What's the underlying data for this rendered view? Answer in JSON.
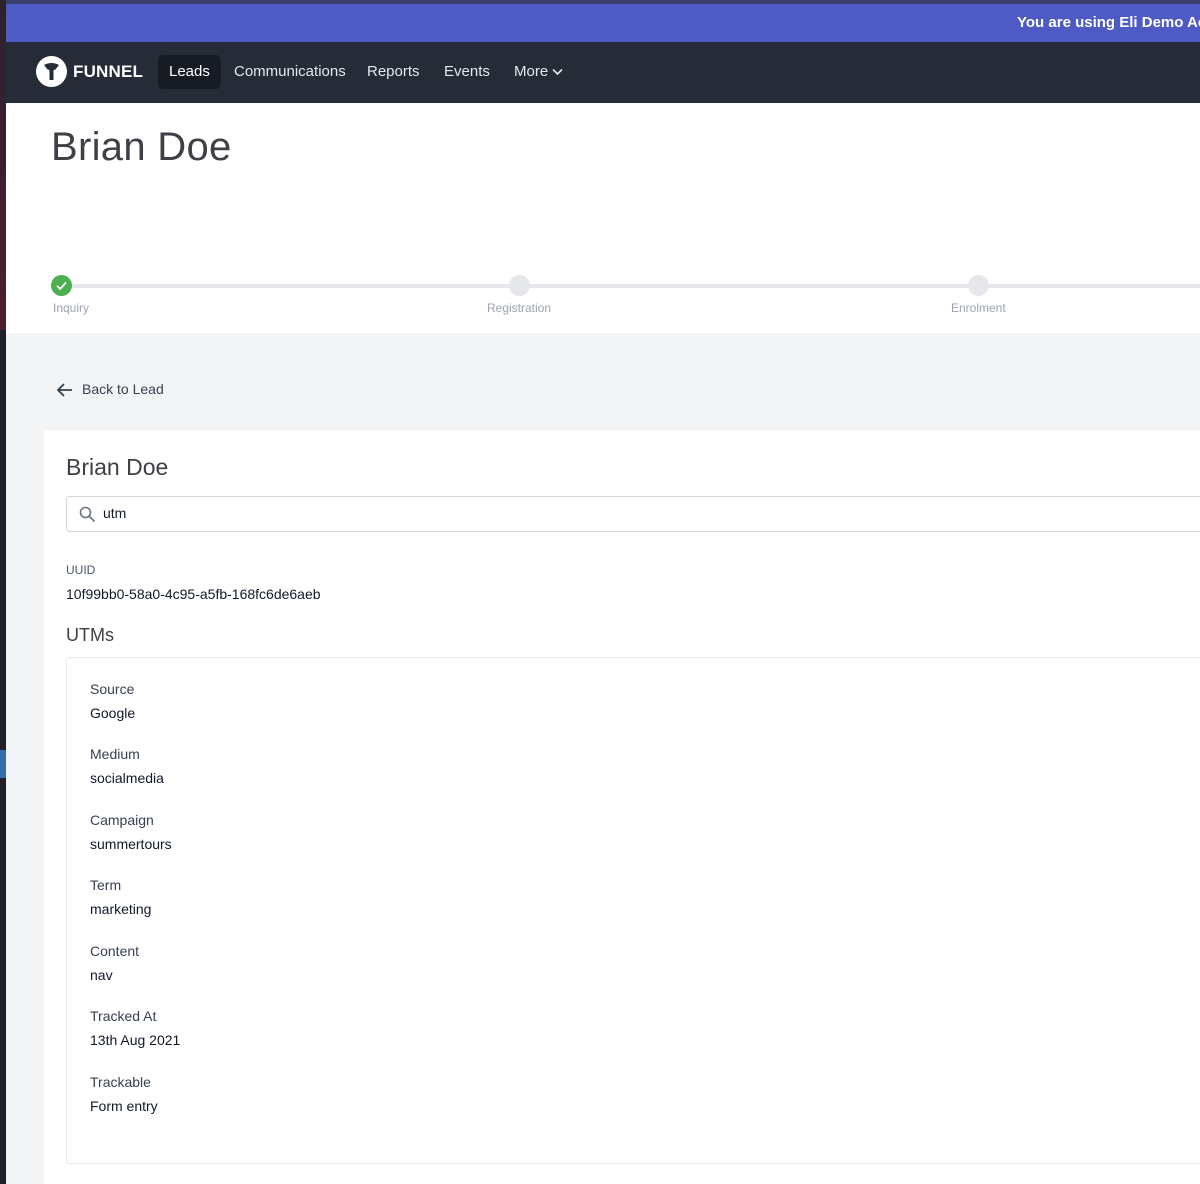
{
  "banner": {
    "message": "You are using Eli Demo Account"
  },
  "nav": {
    "brand": "FUNNEL",
    "items": [
      {
        "label": "Leads",
        "active": true
      },
      {
        "label": "Communications"
      },
      {
        "label": "Reports"
      },
      {
        "label": "Events"
      },
      {
        "label": "More"
      }
    ]
  },
  "header": {
    "name": "Brian Doe"
  },
  "progress": {
    "steps": [
      {
        "label": "Inquiry",
        "complete": true
      },
      {
        "label": "Registration",
        "complete": false
      },
      {
        "label": "Enrolment",
        "complete": false
      }
    ]
  },
  "back_link": {
    "label": "Back to Lead"
  },
  "card": {
    "title": "Brian Doe",
    "search": {
      "value": "utm"
    },
    "uuid": {
      "label": "UUID",
      "value": "10f99bb0-58a0-4c95-a5fb-168fc6de6aeb"
    },
    "utms": {
      "title": "UTMs",
      "fields": [
        {
          "label": "Source",
          "value": "Google"
        },
        {
          "label": "Medium",
          "value": "socialmedia"
        },
        {
          "label": "Campaign",
          "value": "summertours"
        },
        {
          "label": "Term",
          "value": "marketing"
        },
        {
          "label": "Content",
          "value": "nav"
        },
        {
          "label": "Tracked At",
          "value": "13th Aug 2021"
        },
        {
          "label": "Trackable",
          "value": "Form entry"
        }
      ]
    }
  },
  "colors": {
    "banner": "#4f5bc4",
    "nav": "#252b37",
    "step_complete": "#4caf50"
  }
}
